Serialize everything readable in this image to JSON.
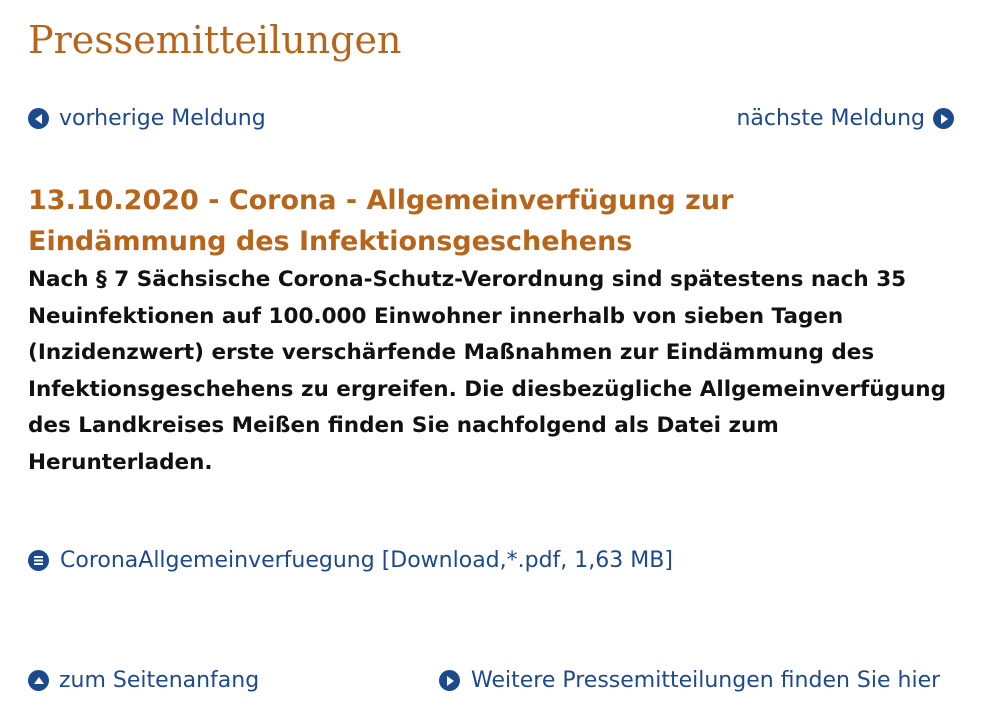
{
  "page": {
    "title": "Pressemitteilungen"
  },
  "nav": {
    "prev_label": "vorherige Meldung",
    "next_label": "nächste Meldung"
  },
  "article": {
    "headline": "13.10.2020 - Corona - Allgemeinverfügung zur Eindämmung des Infektionsgeschehens",
    "lead": "Nach § 7 Sächsische Corona-Schutz-Verordnung sind spätestens nach 35 Neuinfektionen auf 100.000 Einwohner innerhalb von sieben Tagen (Inzidenzwert) erste verschärfende Maßnahmen zur Eindämmung des Infektionsgeschehens zu ergreifen. Die diesbezügliche Allgemeinverfügung des Landkreises Meißen finden Sie nachfolgend als Datei zum Herunterladen."
  },
  "download": {
    "label": "CoronaAllgemeinverfuegung [Download,*.pdf, 1,63 MB]"
  },
  "footer": {
    "top_label": "zum Seitenanfang",
    "more_label": "Weitere Pressemitteilungen finden Sie hier"
  },
  "colors": {
    "accent": "#b8651c",
    "link": "#1c4a8c",
    "text": "#111111"
  },
  "icons": {
    "prev": "arrow-left-circle-icon",
    "next": "arrow-right-circle-icon",
    "document": "document-list-icon",
    "top": "arrow-up-circle-icon",
    "more": "arrow-right-circle-icon"
  }
}
